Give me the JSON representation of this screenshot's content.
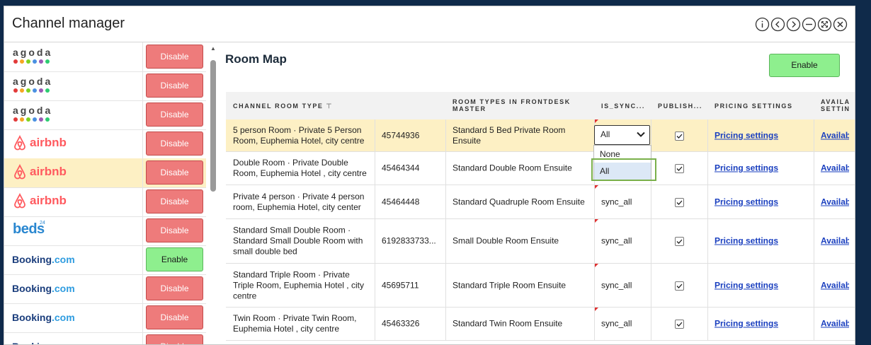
{
  "window": {
    "title": "Channel manager"
  },
  "controls": [
    "info-icon",
    "prev-icon",
    "next-icon",
    "minimize-icon",
    "expand-icon",
    "close-icon"
  ],
  "channels": [
    {
      "logo": "agoda",
      "button": "Disable",
      "selected": false
    },
    {
      "logo": "agoda",
      "button": "Disable",
      "selected": false
    },
    {
      "logo": "agoda",
      "button": "Disable",
      "selected": false
    },
    {
      "logo": "airbnb",
      "button": "Disable",
      "selected": false
    },
    {
      "logo": "airbnb",
      "button": "Disable",
      "selected": true
    },
    {
      "logo": "airbnb",
      "button": "Disable",
      "selected": false
    },
    {
      "logo": "beds24",
      "button": "Disable",
      "selected": false
    },
    {
      "logo": "booking",
      "button": "Enable",
      "selected": false
    },
    {
      "logo": "booking",
      "button": "Disable",
      "selected": false
    },
    {
      "logo": "booking",
      "button": "Disable",
      "selected": false
    },
    {
      "logo": "booking",
      "button": "Disable",
      "selected": false
    }
  ],
  "logos": {
    "agoda": "agoda",
    "airbnb": "airbnb",
    "beds": "beds",
    "beds_sup": "24",
    "booking_1": "Booking",
    "booking_2": ".com"
  },
  "colors": {
    "accent_disable": "#ee7b7b",
    "accent_enable": "#8eef8e",
    "highlight_row": "#fdf0c4",
    "link": "#1a3fbf",
    "focus_ring": "#7ab04a",
    "agoda_dots": [
      "#e23a3a",
      "#f5a623",
      "#7ed321",
      "#4a90e2",
      "#9b59b6",
      "#2ecc71"
    ]
  },
  "main": {
    "title": "Room Map",
    "enable_label": "Enable",
    "headers": {
      "channel_room_type": "CHANNEL ROOM TYPE",
      "room_types_line1": "ROOM TYPES IN FRONTDESK",
      "room_types_line2": "MASTER",
      "is_sync": "IS_SYNC...",
      "publish": "PUBLISH...",
      "pricing": "PRICING SETTINGS",
      "avail_line1": "AVAILA",
      "avail_line2": "SETTIN"
    },
    "rows": [
      {
        "room": "5 person Room · Private 5 Person Room, Euphemia Hotel, city centre",
        "id": "45744936",
        "master": "Standard 5 Bed Private Room Ensuite",
        "sync": "All",
        "published": true,
        "pricing": "Pricing settings",
        "avail": "Availab"
      },
      {
        "room": "Double Room · Private Double Room, Euphemia Hotel , city centre",
        "id": "45464344",
        "master": "Standard Double Room Ensuite",
        "sync": "",
        "published": true,
        "pricing": "Pricing settings",
        "avail": "Availab"
      },
      {
        "room": "Private 4 person · Private 4 person room, Euphemia Hotel, city center",
        "id": "45464448",
        "master": "Standard Quadruple Room Ensuite",
        "sync": "sync_all",
        "published": true,
        "pricing": "Pricing settings",
        "avail": "Availab"
      },
      {
        "room": "Standard Small Double Room · Standard Small Double Room with small double bed",
        "id": "6192833733...",
        "master": "Small Double Room Ensuite",
        "sync": "sync_all",
        "published": true,
        "pricing": "Pricing settings",
        "avail": "Availab"
      },
      {
        "room": "Standard Triple Room · Private Triple Room, Euphemia Hotel , city centre",
        "id": "45695711",
        "master": "Standard Triple Room Ensuite",
        "sync": "sync_all",
        "published": true,
        "pricing": "Pricing settings",
        "avail": "Availab"
      },
      {
        "room": "Twin Room · Private Twin Room, Euphemia Hotel , city centre",
        "id": "45463326",
        "master": "Standard Twin Room Ensuite",
        "sync": "sync_all",
        "published": true,
        "pricing": "Pricing settings",
        "avail": "Availab"
      }
    ],
    "select": {
      "value": "All",
      "options": [
        "None",
        "All"
      ],
      "highlighted": "All"
    }
  }
}
